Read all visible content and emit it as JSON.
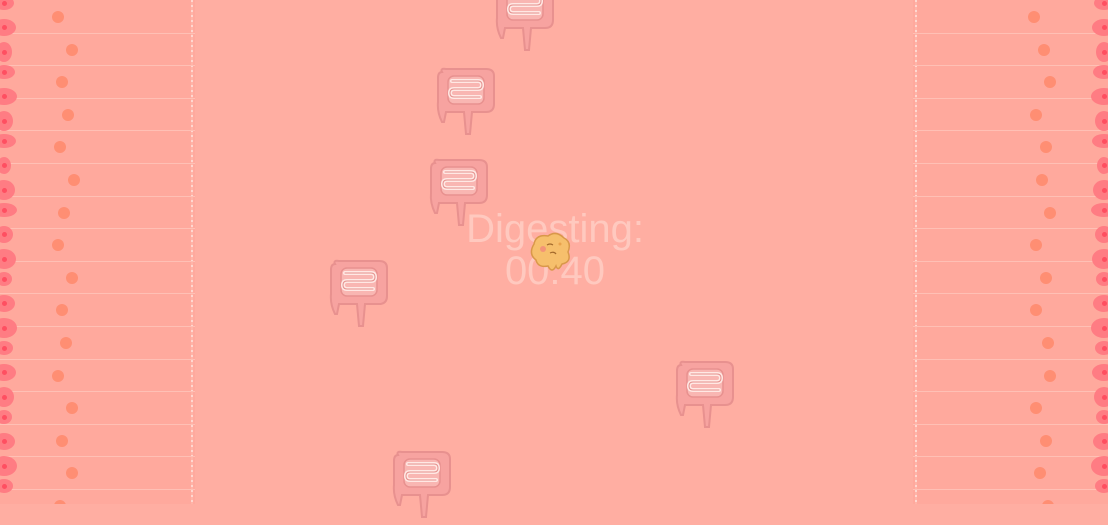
{
  "hud": {
    "label": "Digesting:",
    "timer": "00:40"
  },
  "colors": {
    "background": "#ffaea2",
    "wall": "#ffa99d",
    "villus_cell": "#ff8e73",
    "fold": "#ff7c83",
    "intestine_outline": "#ec9e9c",
    "food": "#f6bf6c"
  },
  "sprites": {
    "player": "food-blob",
    "obstacle": "intestine-icon"
  }
}
